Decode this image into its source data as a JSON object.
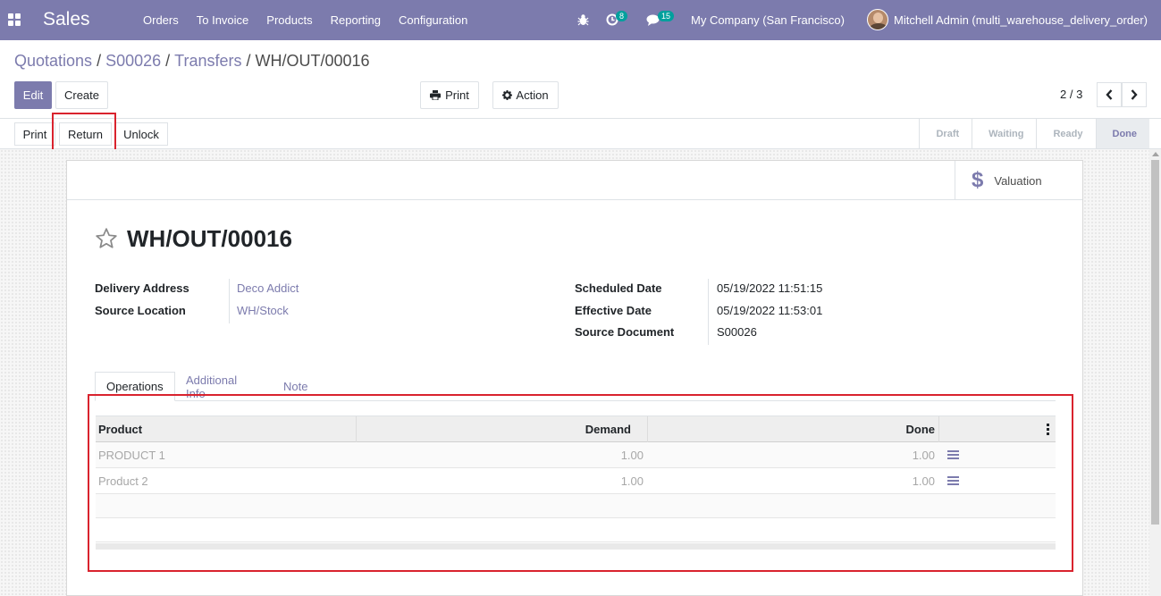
{
  "navbar": {
    "app_name": "Sales",
    "menu": [
      "Orders",
      "To Invoice",
      "Products",
      "Reporting",
      "Configuration"
    ],
    "activity_count": "8",
    "message_count": "15",
    "company": "My Company (San Francisco)",
    "user": "Mitchell Admin (multi_warehouse_delivery_order)"
  },
  "breadcrumb": [
    "Quotations",
    "S00026",
    "Transfers",
    "WH/OUT/00016"
  ],
  "control": {
    "edit": "Edit",
    "create": "Create",
    "print": "Print",
    "action": "Action",
    "pager": "2 / 3"
  },
  "statusbar": {
    "print": "Print",
    "return": "Return",
    "unlock": "Unlock",
    "stages": [
      "Draft",
      "Waiting",
      "Ready",
      "Done"
    ],
    "current_stage": "Done"
  },
  "smart_buttons": {
    "valuation": "Valuation"
  },
  "record": {
    "name": "WH/OUT/00016",
    "left_fields": [
      {
        "label": "Delivery Address",
        "value": "Deco Addict"
      },
      {
        "label": "Source Location",
        "value": "WH/Stock"
      }
    ],
    "right_fields": [
      {
        "label": "Scheduled Date",
        "value": "05/19/2022 11:51:15"
      },
      {
        "label": "Effective Date",
        "value": "05/19/2022 11:53:01"
      },
      {
        "label": "Source Document",
        "value": "S00026"
      }
    ]
  },
  "tabs": [
    "Operations",
    "Additional Info",
    "Note"
  ],
  "operations": {
    "columns": [
      "Product",
      "Demand",
      "Done"
    ],
    "rows": [
      {
        "product": "PRODUCT 1",
        "demand": "1.00",
        "done": "1.00"
      },
      {
        "product": "Product 2",
        "demand": "1.00",
        "done": "1.00"
      }
    ]
  },
  "colors": {
    "primary": "#7c7bad",
    "highlight": "#d9232e",
    "badge": "#00a09d"
  }
}
